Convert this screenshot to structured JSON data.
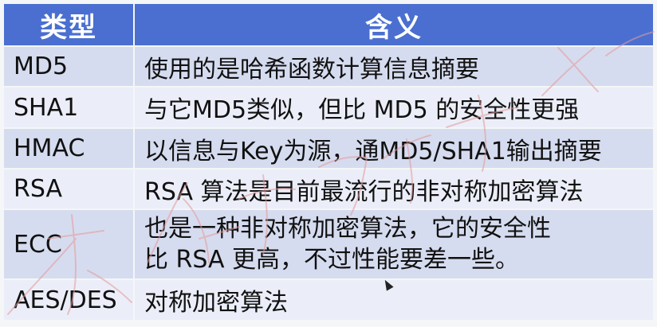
{
  "table": {
    "header": {
      "type": "类型",
      "meaning": "含义"
    },
    "rows": [
      {
        "type": "MD5",
        "meaning": [
          "使用的是哈希函数计算信息摘要"
        ]
      },
      {
        "type": "SHA1",
        "meaning": [
          "与它MD5类似，但比 MD5 的安全性更强"
        ]
      },
      {
        "type": "HMAC",
        "meaning": [
          "以信息与Key为源，通MD5/SHA1输出摘要"
        ]
      },
      {
        "type": "RSA",
        "meaning": [
          "RSA 算法是目前最流行的非对称加密算法"
        ]
      },
      {
        "type": "ECC",
        "meaning": [
          "也是一种非对称加密算法，它的安全性",
          "比 RSA 更高，不过性能要差一些。"
        ]
      },
      {
        "type": "AES/DES",
        "meaning": [
          "对称加密算法"
        ]
      }
    ]
  },
  "colors": {
    "header_bg": "#4a6fd0",
    "row_odd_bg": "#d6dcef",
    "row_even_bg": "#ebeef8",
    "watermark": "#e39a9a"
  },
  "icons": [
    "mouse-cursor-icon"
  ]
}
